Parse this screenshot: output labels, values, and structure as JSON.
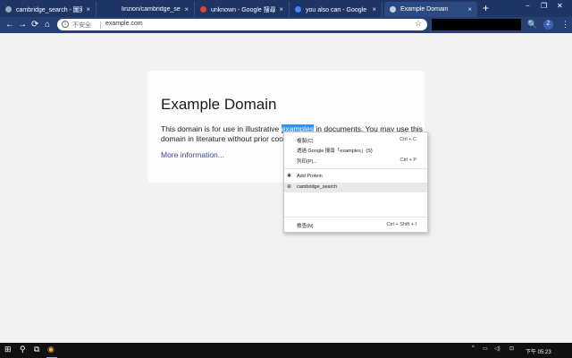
{
  "tabs": [
    {
      "title": "cambridge_search - 圖案匯出",
      "close": "×",
      "fav_color": "#9aa6bd"
    },
    {
      "title": "linzion/cambridge_search_d",
      "close": "×",
      "fav_color": "#ffffff"
    },
    {
      "title": "unknown - Google 搜尋",
      "close": "×",
      "fav_color": "#db4437"
    },
    {
      "title": "you also can - Google 搜尋",
      "close": "×",
      "fav_color": "#4285f4"
    },
    {
      "title": "Example Domain",
      "close": "×",
      "fav_color": "#c7d1e4"
    }
  ],
  "newtab_label": "+",
  "window_controls": {
    "min": "−",
    "max": "❐",
    "close": "✕"
  },
  "nav": {
    "back": "←",
    "forward": "→",
    "reload": "⟳",
    "home": "⌂"
  },
  "omnibox": {
    "info": "i",
    "insecure_label": "不安全",
    "url": "example.com",
    "star": "☆"
  },
  "toolbar_icons": {
    "search": "🔍",
    "menu": "⋮",
    "profile_initial": "Z"
  },
  "page": {
    "heading": "Example Domain",
    "line1_before": "This domain is for use in illustrative ",
    "line1_selected": "examples",
    "line1_after": " in documents. You may use this",
    "line2": "domain in literature without prior coord",
    "more_link": "More information..."
  },
  "context_menu": {
    "items": [
      {
        "label": "複製(C)",
        "shortcut": "Ctrl + C"
      },
      {
        "label": "透過 Google 搜尋「examples」(S)",
        "shortcut": ""
      },
      {
        "label": "列印(P)...",
        "shortcut": "Ctrl + P"
      },
      {
        "label": "Add Protein",
        "shortcut": "",
        "icon": "✱"
      },
      {
        "label": "cambridge_search",
        "shortcut": "",
        "icon": "⊕"
      },
      {
        "label": "檢查(N)",
        "shortcut": "Ctrl + Shift + I"
      }
    ]
  },
  "taskbar": {
    "start": "⊞",
    "search": "⚲",
    "taskview": "⧉",
    "chrome": "◉",
    "tray": [
      "^",
      "▭",
      "◁)",
      "⊡"
    ],
    "clock": "下午 05:23"
  }
}
